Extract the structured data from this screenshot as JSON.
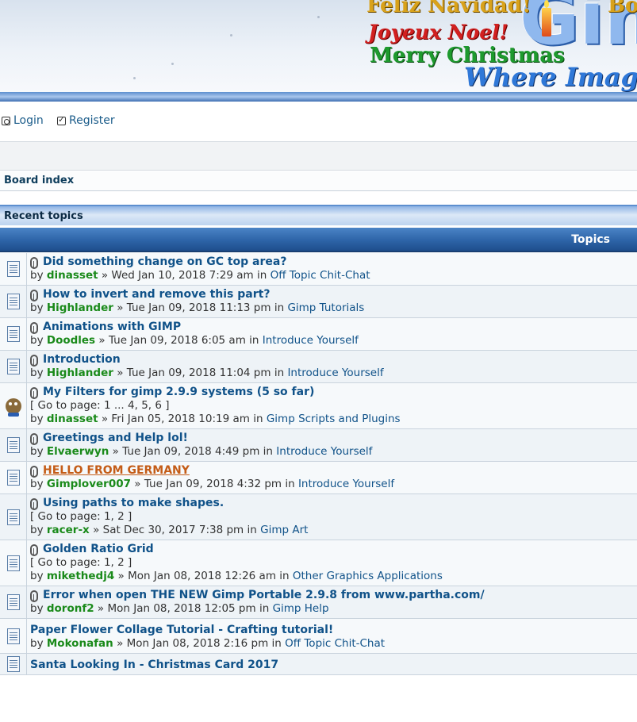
{
  "banner": {
    "greetings": [
      "Feliz Navidad!",
      "Bo",
      "Joyeux Noel!",
      "Merry Christmas",
      "Where Imag"
    ],
    "logo_text": "Gim"
  },
  "userbar": {
    "login_label": "Login",
    "register_label": "Register"
  },
  "breadcrumb": {
    "board_index": "Board index"
  },
  "recent": {
    "title": "Recent topics",
    "column_header": "Topics"
  },
  "topics": [
    {
      "title": "Did something change on GC top area?",
      "attachment": true,
      "pages": [],
      "by": "by",
      "author": "dinasset",
      "sep": "»",
      "date": "Wed Jan 10, 2018 7:29 am",
      "in": "in",
      "forum": "Off Topic Chit-Chat",
      "icon": "document-icon"
    },
    {
      "title": "How to invert and remove this part?",
      "attachment": true,
      "pages": [],
      "by": "by",
      "author": "Highlander",
      "sep": "»",
      "date": "Tue Jan 09, 2018 11:13 pm",
      "in": "in",
      "forum": "Gimp Tutorials",
      "icon": "document-icon"
    },
    {
      "title": "Animations with GIMP",
      "attachment": true,
      "pages": [],
      "by": "by",
      "author": "Doodles",
      "sep": "»",
      "date": "Tue Jan 09, 2018 6:05 am",
      "in": "in",
      "forum": "Introduce Yourself",
      "icon": "document-icon"
    },
    {
      "title": "Introduction",
      "attachment": true,
      "pages": [],
      "by": "by",
      "author": "Highlander",
      "sep": "»",
      "date": "Tue Jan 09, 2018 11:04 pm",
      "in": "in",
      "forum": "Introduce Yourself",
      "icon": "document-icon"
    },
    {
      "title": "My Filters for gimp 2.9.9 systems (5 so far)",
      "attachment": true,
      "pages_text": "[ Go to page: 1 ... 4, 5, 6 ]",
      "by": "by",
      "author": "dinasset",
      "sep": "»",
      "date": "Fri Jan 05, 2018 10:19 am",
      "in": "in",
      "forum": "Gimp Scripts and Plugins",
      "icon": "wilber-icon"
    },
    {
      "title": "Greetings and Help lol!",
      "attachment": true,
      "pages": [],
      "by": "by",
      "author": "Elvaerwyn",
      "sep": "»",
      "date": "Tue Jan 09, 2018 4:49 pm",
      "in": "in",
      "forum": "Introduce Yourself",
      "icon": "document-icon"
    },
    {
      "title": "HELLO FROM GERMANY",
      "attachment": true,
      "special": true,
      "pages": [],
      "by": "by",
      "author": "Gimplover007",
      "sep": "»",
      "date": "Tue Jan 09, 2018 4:32 pm",
      "in": "in",
      "forum": "Introduce Yourself",
      "icon": "document-icon"
    },
    {
      "title": "Using paths to make shapes.",
      "attachment": true,
      "pages_text": "[ Go to page: 1, 2 ]",
      "by": "by",
      "author": "racer-x",
      "sep": "»",
      "date": "Sat Dec 30, 2017 7:38 pm",
      "in": "in",
      "forum": "Gimp Art",
      "icon": "document-icon"
    },
    {
      "title": "Golden Ratio Grid",
      "attachment": true,
      "pages_text": "[ Go to page: 1, 2 ]",
      "by": "by",
      "author": "mikethedj4",
      "sep": "»",
      "date": "Mon Jan 08, 2018 12:26 am",
      "in": "in",
      "forum": "Other Graphics Applications",
      "icon": "document-icon"
    },
    {
      "title": "Error when open THE NEW Gimp Portable 2.9.8 from www.partha.com/",
      "attachment": true,
      "pages": [],
      "by": "by",
      "author": "doronf2",
      "sep": "»",
      "date": "Mon Jan 08, 2018 12:05 pm",
      "in": "in",
      "forum": "Gimp Help",
      "icon": "document-icon"
    },
    {
      "title": "Paper Flower Collage Tutorial - Crafting tutorial!",
      "attachment": false,
      "pages": [],
      "by": "by",
      "author": "Mokonafan",
      "sep": "»",
      "date": "Mon Jan 08, 2018 2:16 pm",
      "in": "in",
      "forum": "Off Topic Chit-Chat",
      "icon": "document-icon"
    },
    {
      "title": "Santa Looking In - Christmas Card 2017",
      "attachment": false,
      "pages": [],
      "by": "",
      "author": "",
      "sep": "",
      "date": "",
      "in": "",
      "forum": "",
      "icon": "document-icon"
    }
  ],
  "colors": {
    "link": "#105289",
    "author": "#1a8a1a",
    "header_blue": "#2d64a8",
    "special_title": "#c45c17"
  }
}
